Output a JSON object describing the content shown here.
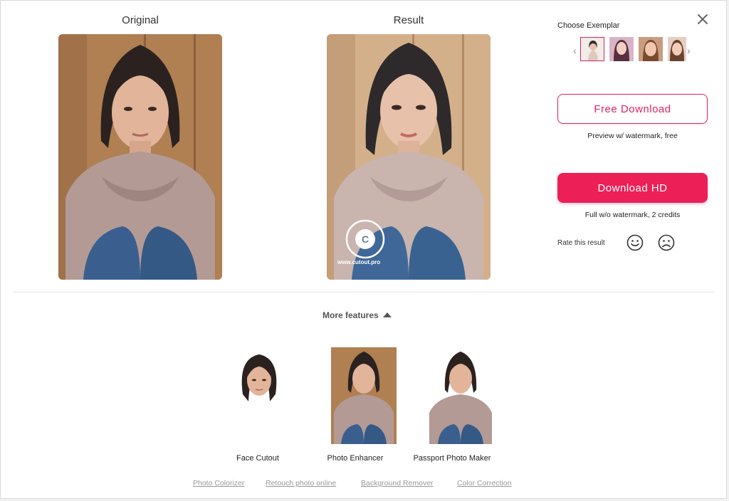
{
  "columns": {
    "original_title": "Original",
    "result_title": "Result"
  },
  "watermark": {
    "ring_text": "www.cutout.pro",
    "caption": "www.cutout.pro",
    "letter": "C"
  },
  "sidebar": {
    "exemplar_label": "Choose Exemplar",
    "prev_arrow": "‹",
    "next_arrow": "›",
    "free_download_label": "Free Download",
    "free_caption": "Preview w/ watermark, free",
    "hd_download_label": "Download HD",
    "hd_caption": "Full w/o watermark, 2 credits",
    "rate_label": "Rate this result"
  },
  "more_features": {
    "label": "More features",
    "items": [
      {
        "label": "Face Cutout"
      },
      {
        "label": "Photo Enhancer"
      },
      {
        "label": "Passport Photo Maker"
      }
    ]
  },
  "links": [
    "Photo Colorizer",
    "Retouch photo online",
    "Background Remover",
    "Color Correction"
  ],
  "colors": {
    "accent": "#ec1f57",
    "outline_accent": "#e0245e"
  }
}
